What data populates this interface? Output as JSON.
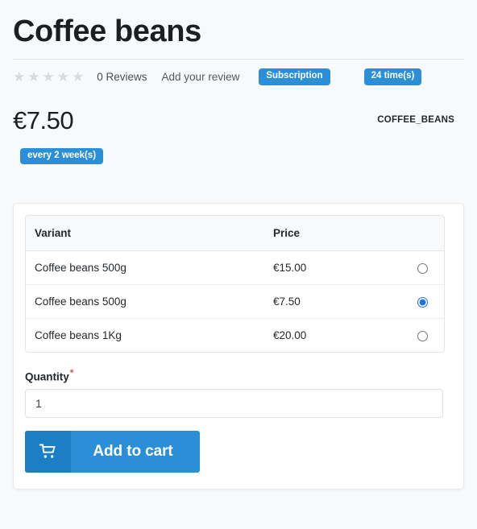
{
  "product": {
    "title": "Coffee beans",
    "internal_reference": "COFFEE_BEANS",
    "price": "€7.50",
    "recurrence_badge": "every 2 week(s)",
    "subscription_badge": "Subscription",
    "duration_badge": "24 time(s)"
  },
  "reviews": {
    "stars": [
      "★",
      "★",
      "★",
      "★",
      "★"
    ],
    "count_label": "0 Reviews",
    "add_review_label": "Add your review",
    "star_color": "#d8dadd"
  },
  "variants_table": {
    "headers": {
      "variant": "Variant",
      "price": "Price"
    },
    "rows": [
      {
        "variant": "Coffee beans 500g",
        "price": "€15.00",
        "selected": false
      },
      {
        "variant": "Coffee beans 500g",
        "price": "€7.50",
        "selected": true
      },
      {
        "variant": "Coffee beans 1Kg",
        "price": "€20.00",
        "selected": false
      }
    ]
  },
  "quantity": {
    "label": "Quantity",
    "required_marker": "*",
    "value": "1"
  },
  "actions": {
    "add_to_cart_label": "Add to cart",
    "cart_icon": "shopping-cart-icon"
  },
  "theme": {
    "accent_blue": "#2b8fd8",
    "accent_blue_dark": "#1a7fc4",
    "radio_selected": "#1a73e8",
    "page_background": "#f8f9fb",
    "card_background": "#ffffff",
    "required_red": "#d9534f"
  }
}
